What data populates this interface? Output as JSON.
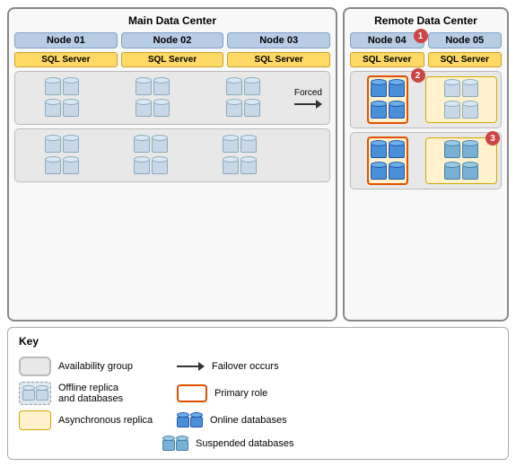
{
  "diagram": {
    "main_dc_title": "Main Data Center",
    "remote_dc_title": "Remote Data Center",
    "nodes": {
      "node01": "Node 01",
      "node02": "Node 02",
      "node03": "Node 03",
      "node04": "Node 04",
      "node05": "Node 05"
    },
    "sql_server": "SQL Server",
    "forced_label": "Forced",
    "badges": {
      "b1": "1",
      "b2": "2",
      "b3": "3"
    }
  },
  "legend": {
    "title": "Key",
    "items": [
      {
        "id": "ag",
        "label": "Availability group"
      },
      {
        "id": "failover",
        "label": "Failover occurs"
      },
      {
        "id": "offline",
        "label": "Offline replica\nand databases"
      },
      {
        "id": "primary",
        "label": "Primary role"
      },
      {
        "id": "async",
        "label": "Asynchronous replica"
      },
      {
        "id": "online",
        "label": "Online databases"
      },
      {
        "id": "suspended",
        "label": "Suspended databases"
      }
    ]
  }
}
